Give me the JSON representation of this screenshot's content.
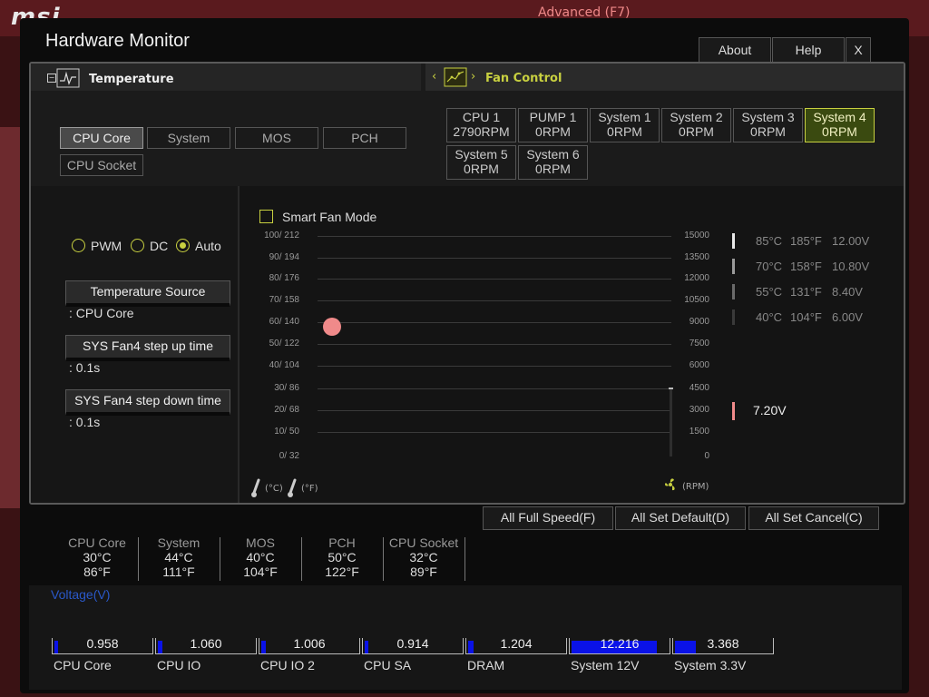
{
  "backdrop": {
    "logo": "msi",
    "advanced": "Advanced (F7)"
  },
  "window": {
    "title": "Hardware Monitor",
    "buttons": {
      "about": "About",
      "help": "Help",
      "close": "X"
    }
  },
  "temperature_section": {
    "header": "Temperature",
    "sources": [
      {
        "label": "CPU Core",
        "active": true
      },
      {
        "label": "System",
        "active": false
      },
      {
        "label": "MOS",
        "active": false
      },
      {
        "label": "PCH",
        "active": false
      },
      {
        "label": "CPU Socket",
        "active": false
      }
    ]
  },
  "fan_section": {
    "header": "Fan Control",
    "fans": [
      {
        "name": "CPU 1",
        "rpm": "2790RPM",
        "active": false
      },
      {
        "name": "PUMP 1",
        "rpm": "0RPM",
        "active": false
      },
      {
        "name": "System 1",
        "rpm": "0RPM",
        "active": false
      },
      {
        "name": "System 2",
        "rpm": "0RPM",
        "active": false
      },
      {
        "name": "System 3",
        "rpm": "0RPM",
        "active": false
      },
      {
        "name": "System 4",
        "rpm": "0RPM",
        "active": true
      },
      {
        "name": "System 5",
        "rpm": "0RPM",
        "active": false
      },
      {
        "name": "System 6",
        "rpm": "0RPM",
        "active": false
      }
    ]
  },
  "fan_settings": {
    "modes": [
      {
        "label": "PWM",
        "selected": false
      },
      {
        "label": "DC",
        "selected": false
      },
      {
        "label": "Auto",
        "selected": true
      }
    ],
    "temperature_source_label": "Temperature Source",
    "temperature_source_value": ": CPU Core",
    "step_up_label": "SYS Fan4 step up time",
    "step_up_value": ": 0.1s",
    "step_down_label": "SYS Fan4 step down time",
    "step_down_value": ": 0.1s"
  },
  "smart_fan": {
    "label": "Smart Fan Mode",
    "checked": false,
    "left_axis_ticks": [
      "100/ 212",
      "90/ 194",
      "80/ 176",
      "70/ 158",
      "60/ 140",
      "50/ 122",
      "40/ 104",
      "30/  86",
      "20/  68",
      "10/  50",
      "0/  32"
    ],
    "right_axis_ticks": [
      "15000",
      "13500",
      "12000",
      "10500",
      "9000",
      "7500",
      "6000",
      "4500",
      "3000",
      "1500",
      "0"
    ],
    "unit_c": "(°C)",
    "unit_f": "(°F)",
    "unit_rpm": "(RPM)",
    "point": {
      "temp_c": 59,
      "fan_rpm": 9000
    },
    "rpm_indicator_value": 0,
    "legend": [
      {
        "c": "85°C",
        "f": "185°F",
        "v": "12.00V"
      },
      {
        "c": "70°C",
        "f": "158°F",
        "v": "10.80V"
      },
      {
        "c": "55°C",
        "f": "131°F",
        "v": "8.40V"
      },
      {
        "c": "40°C",
        "f": "104°F",
        "v": "6.00V"
      }
    ],
    "current_voltage": "7.20V",
    "colors": {
      "point": "#f08a8a",
      "accent": "#c8d040"
    }
  },
  "actions": {
    "full_speed": "All Full Speed(F)",
    "set_default": "All Set Default(D)",
    "set_cancel": "All Set Cancel(C)"
  },
  "temperatures": [
    {
      "name": "CPU Core",
      "c": "30°C",
      "f": "86°F"
    },
    {
      "name": "System",
      "c": "44°C",
      "f": "111°F"
    },
    {
      "name": "MOS",
      "c": "40°C",
      "f": "104°F"
    },
    {
      "name": "PCH",
      "c": "50°C",
      "f": "122°F"
    },
    {
      "name": "CPU Socket",
      "c": "32°C",
      "f": "89°F"
    }
  ],
  "voltage": {
    "title": "Voltage(V)",
    "items": [
      {
        "name": "CPU Core",
        "value": "0.958",
        "fill": 0.04
      },
      {
        "name": "CPU IO",
        "value": "1.060",
        "fill": 0.05
      },
      {
        "name": "CPU IO 2",
        "value": "1.006",
        "fill": 0.05
      },
      {
        "name": "CPU SA",
        "value": "0.914",
        "fill": 0.04
      },
      {
        "name": "DRAM",
        "value": "1.204",
        "fill": 0.06
      },
      {
        "name": "System 12V",
        "value": "12.216",
        "fill": 0.9
      },
      {
        "name": "System 3.3V",
        "value": "3.368",
        "fill": 0.22
      }
    ],
    "fill_color": "#0a12e8"
  }
}
